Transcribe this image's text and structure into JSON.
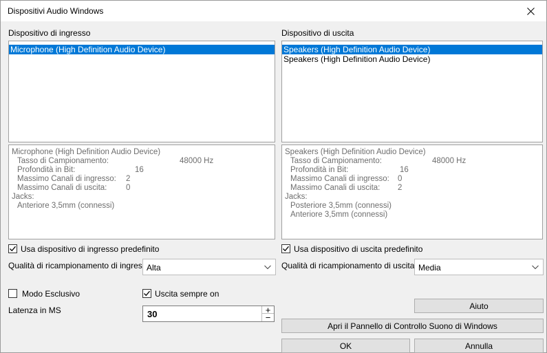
{
  "window": {
    "title": "Dispositivi Audio Windows"
  },
  "input": {
    "header": "Dispositivo di ingresso",
    "devices": [
      "Microphone (High Definition Audio Device)"
    ],
    "info": {
      "device": "Microphone (High Definition Audio Device)",
      "sample_rate_label": "Tasso di Campionamento:",
      "sample_rate_value": "48000 Hz",
      "bit_depth_label": "Profondità in Bit:",
      "bit_depth_value": "16",
      "max_in_label": "Massimo Canali di ingresso:",
      "max_in_value": "2",
      "max_out_label": "Massimo Canali di uscita:",
      "max_out_value": "0",
      "jacks_label": "Jacks:",
      "jacks": [
        "Anteriore 3,5mm (connessi)"
      ]
    },
    "default_checkbox": "Usa dispositivo di ingresso predefinito",
    "quality_label": "Qualità di ricampionamento di ingres",
    "quality_value": "Alta"
  },
  "output": {
    "header": "Dispositivo di uscita",
    "devices": [
      "Speakers (High Definition Audio Device)",
      "Speakers (High Definition Audio Device)"
    ],
    "info": {
      "device": "Speakers (High Definition Audio Device)",
      "sample_rate_label": "Tasso di Campionamento:",
      "sample_rate_value": "48000 Hz",
      "bit_depth_label": "Profondità in Bit:",
      "bit_depth_value": "16",
      "max_in_label": "Massimo Canali di ingresso:",
      "max_in_value": "0",
      "max_out_label": "Massimo Canali di uscita:",
      "max_out_value": "2",
      "jacks_label": "Jacks:",
      "jacks": [
        "Posteriore 3,5mm (connessi)",
        "Anteriore 3,5mm (connessi)"
      ]
    },
    "default_checkbox": "Usa dispositivo di uscita predefinito",
    "quality_label": "Qualità di ricampionamento di uscita",
    "quality_value": "Media"
  },
  "options": {
    "exclusive_mode": "Modo Esclusivo",
    "output_always_on": "Uscita sempre on",
    "latency_label": "Latenza in MS",
    "latency_value": "30"
  },
  "buttons": {
    "help": "Aiuto",
    "control_panel": "Apri il Pannello di Controllo Suono di Windows",
    "ok": "OK",
    "cancel": "Annulla"
  }
}
